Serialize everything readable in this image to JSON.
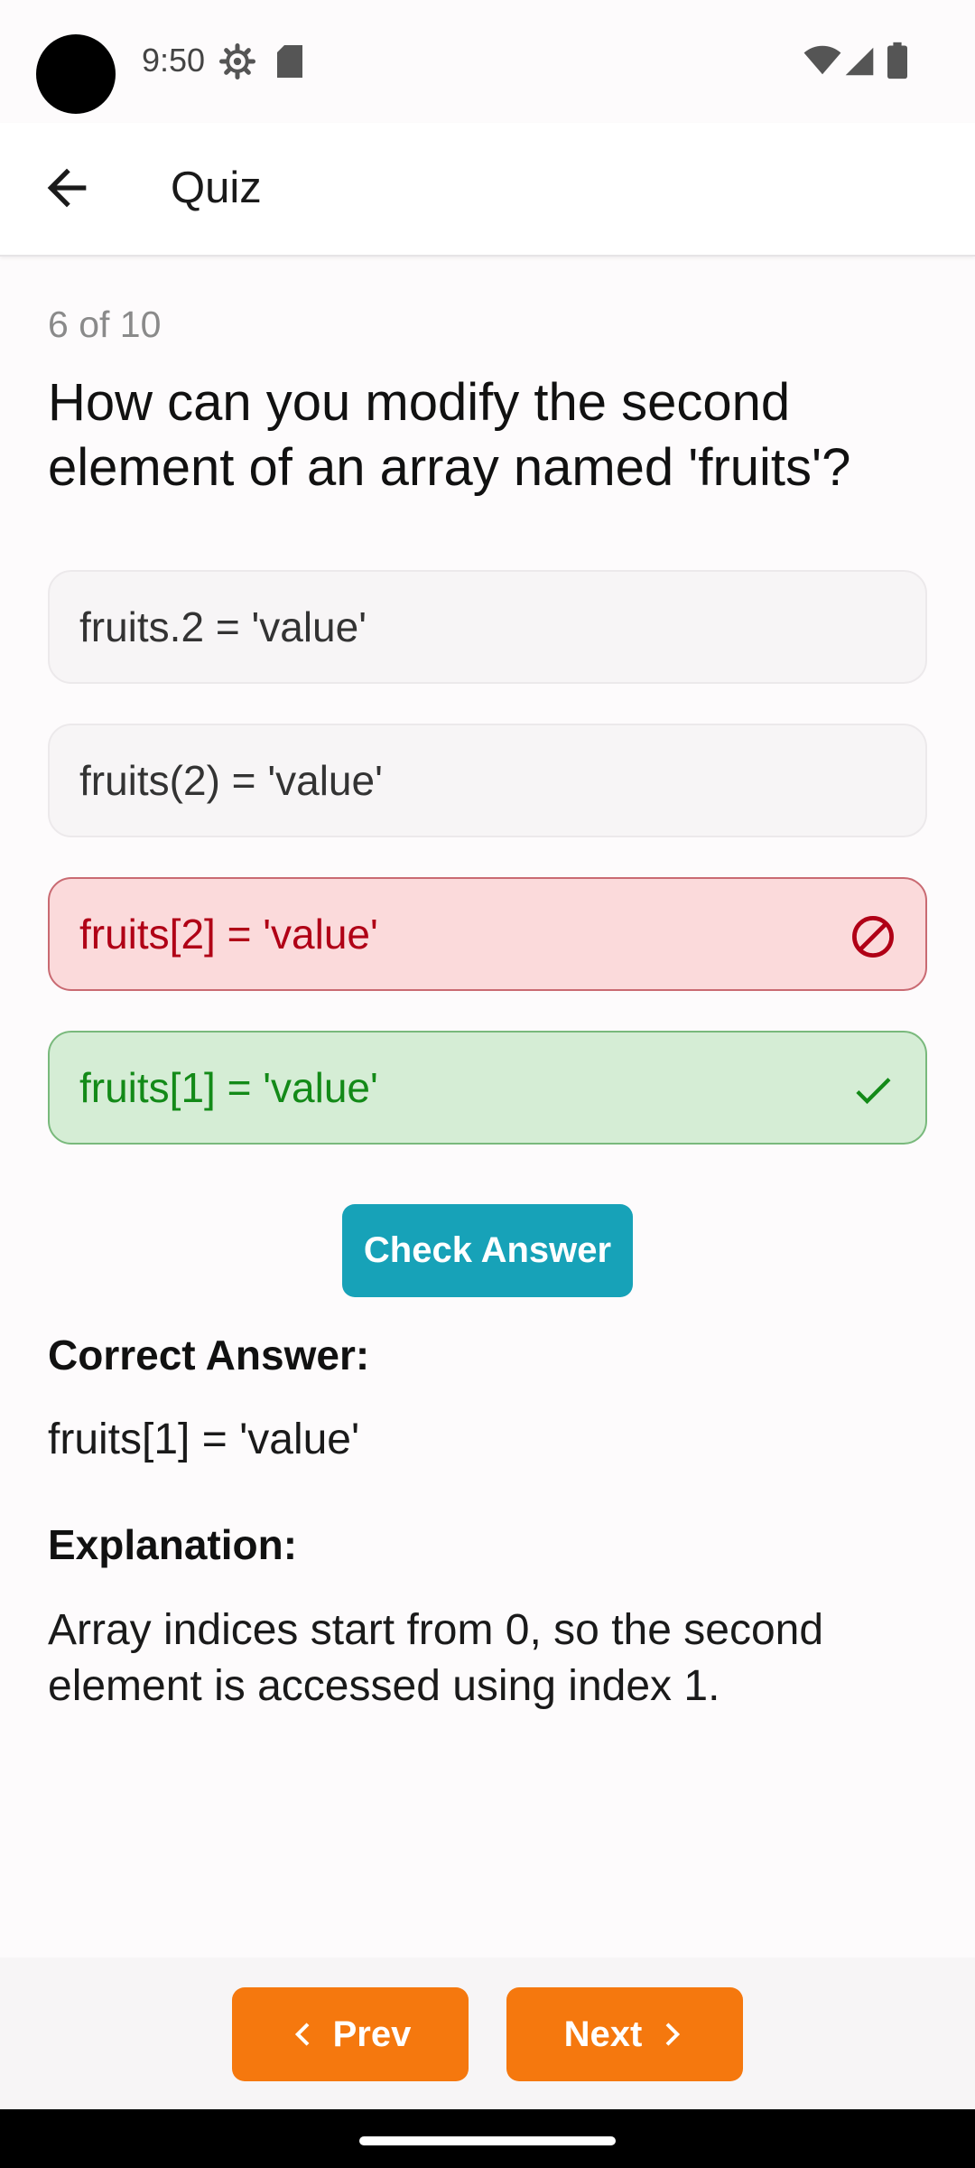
{
  "status_bar": {
    "time": "9:50",
    "icons": [
      "gear-icon",
      "sd-card-icon",
      "wifi-icon",
      "signal-icon",
      "battery-icon"
    ]
  },
  "app_bar": {
    "title": "Quiz",
    "back_icon": "arrow-back-icon"
  },
  "quiz": {
    "progress": "6 of 10",
    "question": "How can you modify the second element of an array named 'fruits'?",
    "options": [
      {
        "label": "fruits.2 = 'value'",
        "state": "neutral"
      },
      {
        "label": "fruits(2) = 'value'",
        "state": "neutral"
      },
      {
        "label": "fruits[2] = 'value'",
        "state": "wrong",
        "icon": "block-icon"
      },
      {
        "label": "fruits[1] = 'value'",
        "state": "correct",
        "icon": "check-icon"
      }
    ],
    "check_button": "Check Answer",
    "correct_answer_label": "Correct Answer:",
    "correct_answer_value": "fruits[1] = 'value'",
    "explanation_label": "Explanation:",
    "explanation_text": "Array indices start from 0, so the second element is accessed using index 1."
  },
  "navigation": {
    "prev_label": "Prev",
    "next_label": "Next"
  },
  "colors": {
    "accent_teal": "#17a2b8",
    "nav_orange": "#f5780e",
    "wrong_bg": "#fbdadb",
    "wrong_text": "#b00016",
    "correct_bg": "#d5edd5",
    "correct_text": "#138a18"
  }
}
